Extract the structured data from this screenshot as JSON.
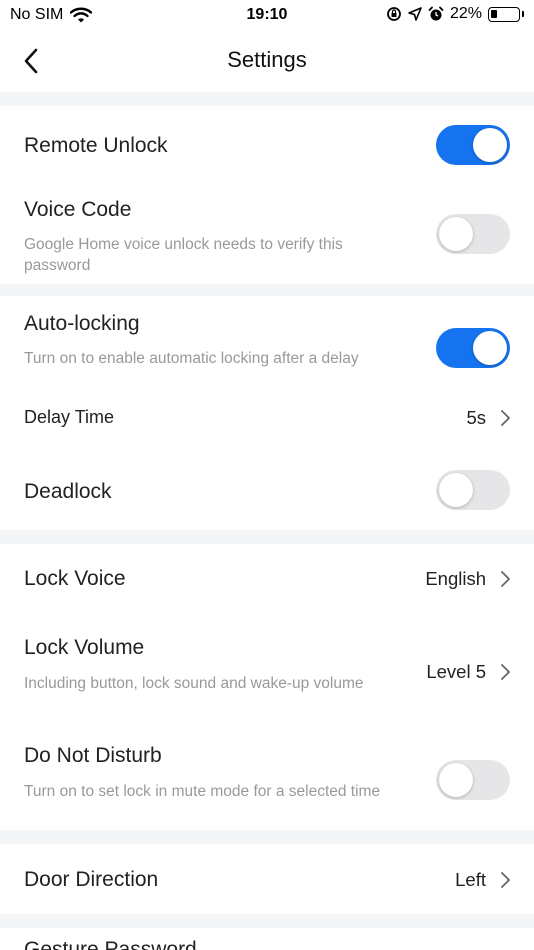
{
  "status_bar": {
    "carrier": "No SIM",
    "time": "19:10",
    "battery_percent": "22%",
    "battery_level": 0.22,
    "icons": [
      "wifi-icon",
      "orientation-lock-icon",
      "location-icon",
      "alarm-icon",
      "battery-icon"
    ]
  },
  "nav": {
    "title": "Settings",
    "back_icon": "chevron-left-icon"
  },
  "settings": {
    "remote_unlock": {
      "label": "Remote Unlock",
      "enabled": true
    },
    "voice_code": {
      "label": "Voice Code",
      "description": "Google Home voice unlock needs to verify this password",
      "enabled": false
    },
    "auto_locking": {
      "label": "Auto-locking",
      "description": "Turn on to enable automatic locking after a delay",
      "enabled": true
    },
    "delay_time": {
      "label": "Delay Time",
      "value": "5s"
    },
    "deadlock": {
      "label": "Deadlock",
      "enabled": false
    },
    "lock_voice": {
      "label": "Lock Voice",
      "value": "English"
    },
    "lock_volume": {
      "label": "Lock Volume",
      "description": "Including button, lock sound and wake-up volume",
      "value": "Level 5"
    },
    "do_not_disturb": {
      "label": "Do Not Disturb",
      "description": "Turn on to set lock in mute mode for a selected time",
      "enabled": false
    },
    "door_direction": {
      "label": "Door Direction",
      "value": "Left"
    },
    "gesture_password": {
      "label": "Gesture Password"
    }
  },
  "colors": {
    "toggle_on": "#1673f0",
    "toggle_off": "#e6e6e8",
    "section_gap": "#f4f5f6",
    "secondary_text": "#999999"
  }
}
